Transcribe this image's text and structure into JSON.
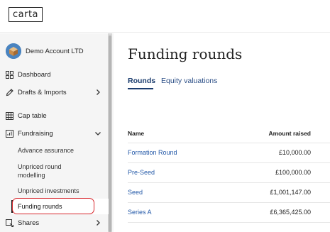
{
  "app": {
    "logo_text": "carta",
    "account_name": "Demo Account LTD"
  },
  "sidebar": {
    "items": [
      {
        "label": "Dashboard",
        "icon": "dashboard-grid-icon"
      },
      {
        "label": "Drafts & Imports",
        "icon": "pen-icon",
        "chevron": "chevron-right-icon"
      },
      {
        "label": "Cap table",
        "icon": "table-icon"
      },
      {
        "label": "Fundraising",
        "icon": "chart-icon",
        "chevron": "chevron-down-icon"
      }
    ],
    "fundraising_sub": [
      {
        "label": "Advance assurance"
      },
      {
        "label": "Unpriced round\nmodelling"
      },
      {
        "label": "Unpriced investments"
      },
      {
        "label": "Funding rounds",
        "active": true
      }
    ],
    "shares": {
      "label": "Shares",
      "icon": "shares-icon",
      "chevron": "chevron-right-icon"
    }
  },
  "main": {
    "title": "Funding rounds",
    "tabs": [
      {
        "label": "Rounds",
        "active": true
      },
      {
        "label": "Equity valuations",
        "active": false
      }
    ],
    "table": {
      "columns": [
        "Name",
        "Amount raised"
      ],
      "rows": [
        {
          "name": "Formation Round",
          "amount": "£10,000.00"
        },
        {
          "name": "Pre-Seed",
          "amount": "£100,000.00"
        },
        {
          "name": "Seed",
          "amount": "£1,001,147.00"
        },
        {
          "name": "Series A",
          "amount": "£6,365,425.00"
        }
      ]
    }
  },
  "colors": {
    "accent": "#1b3c6e",
    "link": "#2459a8",
    "highlight_ring": "#d8262c",
    "sidebar_bg": "#f5f5f5"
  }
}
